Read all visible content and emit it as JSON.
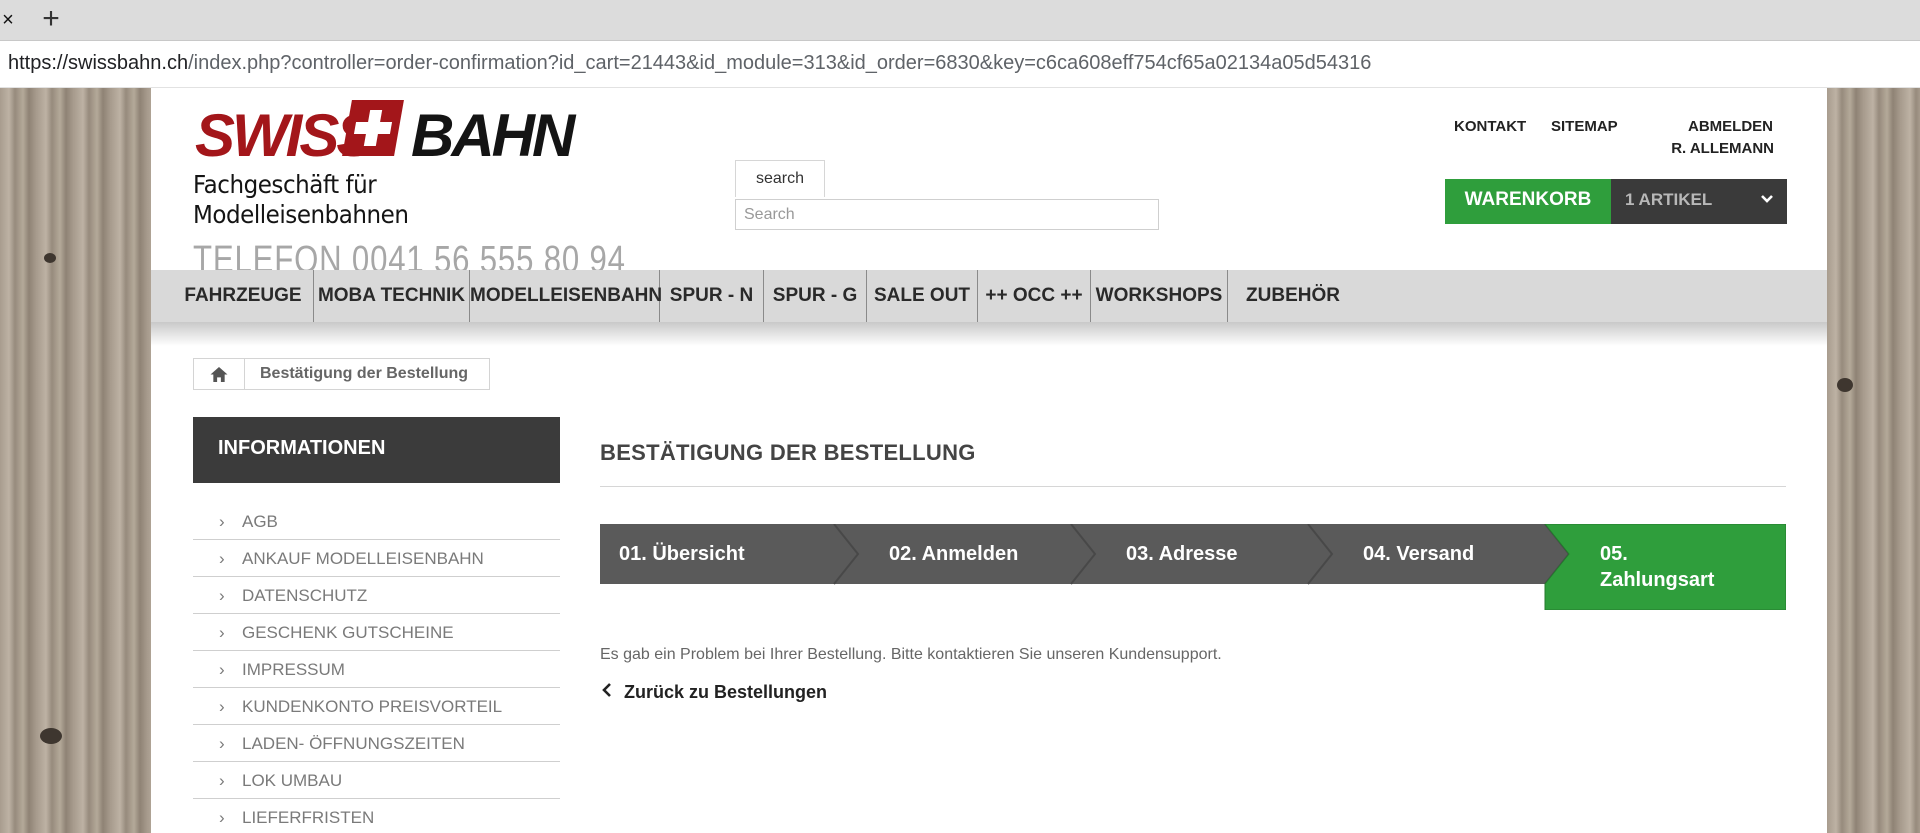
{
  "browser": {
    "url_host": "https://swissbahn.ch",
    "url_path": "/index.php?controller=order-confirmation?id_cart=21443&id_module=313&id_order=6830&key=c6ca608eff754cf65a02134a05d54316",
    "tab_close": "×",
    "new_tab": "+"
  },
  "header": {
    "logo_swiss": "SWISS",
    "logo_bahn": "BAHN",
    "logo_subtitle": "Fachgeschäft für Modelleisenbahnen",
    "logo_phone": "TELEFON 0041 56 555 80 94",
    "search_button": "search",
    "search_placeholder": "Search",
    "links": {
      "kontakt": "KONTAKT",
      "sitemap": "SITEMAP",
      "abmelden": "ABMELDEN",
      "user": "R. ALLEMANN"
    },
    "cart": {
      "label": "WARENKORB",
      "count": "1 ARTIKEL"
    }
  },
  "nav": {
    "items": [
      "FAHRZEUGE",
      "MOBA TECHNIK",
      "MODELLEISENBAHN",
      "SPUR - N",
      "SPUR - G",
      "SALE OUT",
      "++ OCC ++",
      "WORKSHOPS",
      "ZUBEHÖR"
    ]
  },
  "breadcrumb": {
    "current": "Bestätigung der Bestellung"
  },
  "sidebar": {
    "title": "INFORMATIONEN",
    "items": [
      "AGB",
      "ANKAUF MODELLEISENBAHN",
      "DATENSCHUTZ",
      "GESCHENK GUTSCHEINE",
      "IMPRESSUM",
      "KUNDENKONTO PREISVORTEIL",
      "LADEN- ÖFFNUNGSZEITEN",
      "LOK UMBAU",
      "LIEFERFRISTEN"
    ],
    "chevron": "›"
  },
  "main": {
    "title": "BESTÄTIGUNG DER BESTELLUNG",
    "steps": [
      {
        "label": "01. Übersicht",
        "state": "done"
      },
      {
        "label": "02. Anmelden",
        "state": "done"
      },
      {
        "label": "03. Adresse",
        "state": "done"
      },
      {
        "label": "04. Versand",
        "state": "done"
      },
      {
        "label_line1": "05.",
        "label_line2": "Zahlungsart",
        "state": "current"
      }
    ],
    "message": "Es gab ein Problem bei Ihrer Bestellung. Bitte kontaktieren Sie unseren Kundensupport.",
    "back_link": "Zurück zu Bestellungen"
  },
  "colors": {
    "brand_red": "#a3161a",
    "accent_green": "#2f9e3c",
    "step_gray": "#5a5a5a",
    "dark": "#3b3b3b",
    "nav_bg": "#d9d9d9"
  }
}
